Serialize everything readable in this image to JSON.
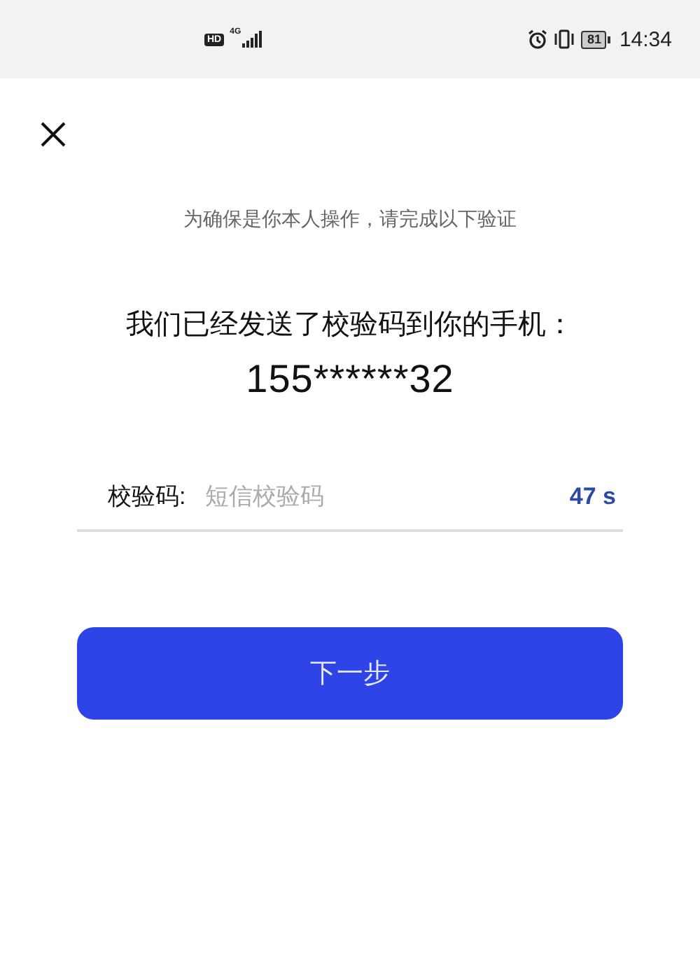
{
  "status_bar": {
    "hd": "HD",
    "network": "4G",
    "battery": "81",
    "time": "14:34"
  },
  "notice": "为确保是你本人操作，请完成以下验证",
  "heading": "我们已经发送了校验码到你的手机：",
  "phone": "155******32",
  "code_field": {
    "label": "校验码:",
    "placeholder": "短信校验码",
    "countdown": "47 s"
  },
  "next_button": "下一步"
}
